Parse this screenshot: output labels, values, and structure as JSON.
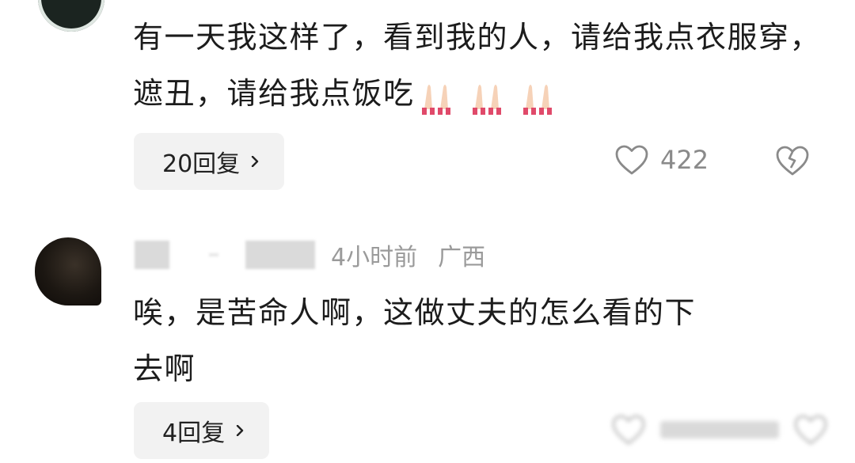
{
  "comments": [
    {
      "text": "有一天我这样了，看到我的人，请给我点衣服穿，遮丑，请给我点饭吃",
      "emoji": "folded-hands-icon",
      "reply_label": "20回复",
      "like_count": "422"
    },
    {
      "time": "4小时前",
      "location": "广西",
      "text_line1": "唉，是苦命人啊，这做丈夫的怎么看的下",
      "text_line2": "去啊",
      "reply_label": "4回复"
    }
  ]
}
